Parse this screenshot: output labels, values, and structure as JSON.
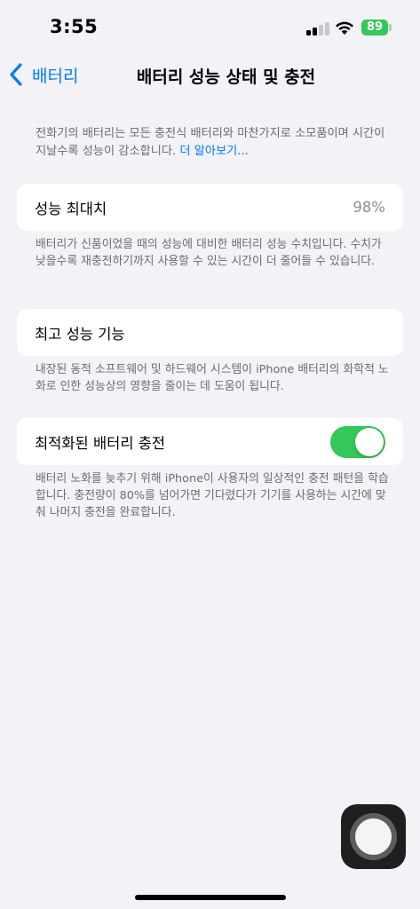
{
  "status_bar": {
    "time": "3:55",
    "battery_level": "89",
    "battery_color": "#34c759"
  },
  "nav": {
    "back_label": "배터리",
    "title": "배터리 성능 상태 및 충전",
    "back_icon": "chevron-left-icon"
  },
  "intro": {
    "text": "전화기의 배터리는 모든 충전식 배터리와 마찬가지로 소모품이며 시간이 지날수록 성능이 감소합니다. ",
    "link": "더 알아보기..."
  },
  "max_capacity": {
    "label": "성능 최대치",
    "value": "98%",
    "footnote": "배터리가 신품이었을 때의 성능에 대비한 배터리 성능 수치입니다. 수치가 낮을수록 재충전하기까지 사용할 수 있는 시간이 더 줄어들 수 있습니다."
  },
  "peak_performance": {
    "label": "최고 성능 기능",
    "footnote": "내장된 동적 소프트웨어 및 하드웨어 시스템이 iPhone 배터리의 화학적 노화로 인한 성능상의 영향을 줄이는 데 도움이 됩니다."
  },
  "optimized_charging": {
    "label": "최적화된 배터리 충전",
    "enabled": true,
    "toggle_color": "#34c759",
    "footnote": "배터리 노화를 늦추기 위해 iPhone이 사용자의 일상적인 충전 패턴을 학습합니다. 충전량이 80%를 넘어가면 기다렸다가 기기를 사용하는 시간에 맞춰 나머지 충전을 완료합니다."
  },
  "accent_color": "#007aff"
}
